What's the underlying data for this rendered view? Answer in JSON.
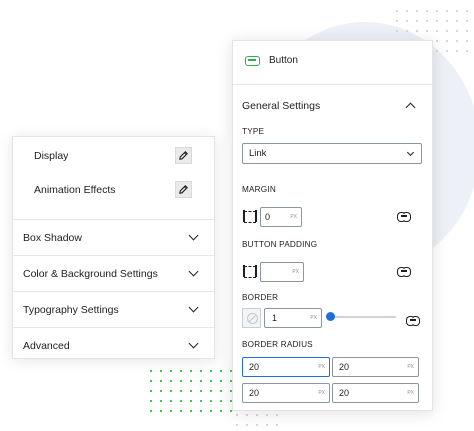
{
  "left_panel": {
    "items": [
      {
        "label": "Display"
      },
      {
        "label": "Animation Effects"
      }
    ],
    "sections": [
      {
        "label": "Box Shadow"
      },
      {
        "label": "Color & Background Settings"
      },
      {
        "label": "Typography Settings"
      },
      {
        "label": "Advanced"
      }
    ]
  },
  "right_panel": {
    "title": "Button",
    "section_title": "General Settings",
    "type": {
      "label": "TYPE",
      "value": "Link"
    },
    "margin": {
      "label": "MARGIN",
      "value": "0",
      "unit": "PX"
    },
    "button_padding": {
      "label": "BUTTON PADDING",
      "value": "",
      "unit": "PX"
    },
    "border": {
      "label": "BORDER",
      "value": "1",
      "unit": "PX",
      "slider_fraction": 0.0
    },
    "border_radius": {
      "label": "BORDER RADIUS",
      "values": [
        "20",
        "20",
        "20",
        "20"
      ],
      "unit": "PX"
    }
  },
  "colors": {
    "accent_green": "#2bb24c",
    "focus_blue": "#1e6fd9"
  },
  "icons": [
    "pencil-icon",
    "chevron-down-icon",
    "chevron-up-icon",
    "button-icon",
    "box-sides-icon",
    "link-icon",
    "border-style-icon"
  ]
}
